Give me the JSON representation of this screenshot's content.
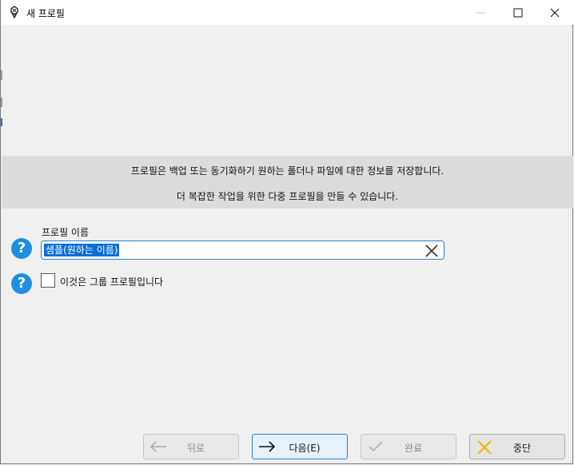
{
  "window": {
    "title": "새 프로필"
  },
  "info": {
    "line1": "프로필은 백업 또는 동기화하기 원하는 폴더나 파일에 대한 정보를 저장합니다.",
    "line2": "더 복잡한 작업을 위한 다중 프로필을 만들 수 있습니다."
  },
  "form": {
    "help_glyph": "?",
    "name_label": "프로필 이름",
    "name_value": "샘플(원하는 이름)",
    "group_label": "이것은 그룹 프로필입니다",
    "group_checked": false
  },
  "buttons": {
    "back": "뒤로",
    "next": "다음(E)",
    "finish": "완료",
    "abort": "중단"
  },
  "colors": {
    "accent": "#2a7fd4",
    "help_icon": "#1e8fe1",
    "selection": "#0a6dd8",
    "abort_icon": "#f2b600"
  }
}
